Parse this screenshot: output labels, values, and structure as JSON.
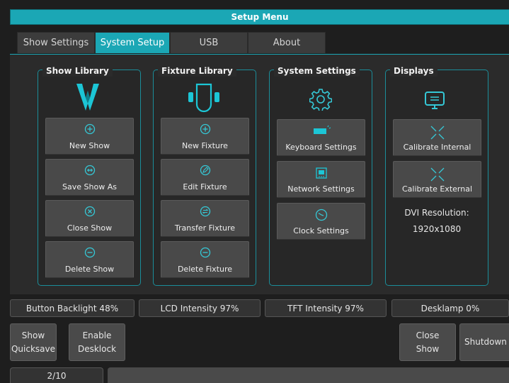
{
  "window": {
    "title": "Setup Menu"
  },
  "tabs": [
    {
      "label": "Show Settings",
      "active": false
    },
    {
      "label": "System Setup",
      "active": true
    },
    {
      "label": "USB",
      "active": false
    },
    {
      "label": "About",
      "active": false
    }
  ],
  "groups": {
    "show_library": {
      "title": "Show Library",
      "icon": "avolites-logo-icon",
      "buttons": [
        {
          "label": "New Show",
          "icon": "plus-circle-icon"
        },
        {
          "label": "Save Show As",
          "icon": "save-as-icon"
        },
        {
          "label": "Close Show",
          "icon": "close-circle-icon"
        },
        {
          "label": "Delete Show",
          "icon": "minus-circle-icon"
        }
      ]
    },
    "fixture_library": {
      "title": "Fixture Library",
      "icon": "fixture-icon",
      "buttons": [
        {
          "label": "New Fixture",
          "icon": "plus-circle-icon"
        },
        {
          "label": "Edit Fixture",
          "icon": "pencil-icon"
        },
        {
          "label": "Transfer Fixture",
          "icon": "transfer-icon"
        },
        {
          "label": "Delete Fixture",
          "icon": "minus-circle-icon"
        }
      ]
    },
    "system_settings": {
      "title": "System Settings",
      "icon": "gear-icon",
      "buttons": [
        {
          "label": "Keyboard Settings",
          "icon": "keyboard-icon"
        },
        {
          "label": "Network Settings",
          "icon": "network-icon"
        },
        {
          "label": "Clock Settings",
          "icon": "clock-icon"
        }
      ]
    },
    "displays": {
      "title": "Displays",
      "icon": "monitor-icon",
      "buttons": [
        {
          "label": "Calibrate Internal",
          "icon": "crosshair-icon"
        },
        {
          "label": "Calibrate External",
          "icon": "crosshair-icon"
        }
      ],
      "dvi_label": "DVI Resolution:",
      "dvi_value": "1920x1080"
    }
  },
  "status_bar": {
    "backlight": "Button Backlight 48%",
    "lcd": "LCD Intensity 97%",
    "tft": "TFT Intensity 97%",
    "desklamp": "Desklamp 0%"
  },
  "bottom_buttons": {
    "show_quicksave": [
      "Show",
      "Quicksave"
    ],
    "enable_desklock": [
      "Enable",
      "Desklock"
    ],
    "close_show": [
      "Close",
      "Show"
    ],
    "shutdown": "Shutdown"
  },
  "page_indicator": "2/10",
  "colors": {
    "accent": "#1ba7b5",
    "button": "#494949",
    "background": "#2b2b2b"
  }
}
